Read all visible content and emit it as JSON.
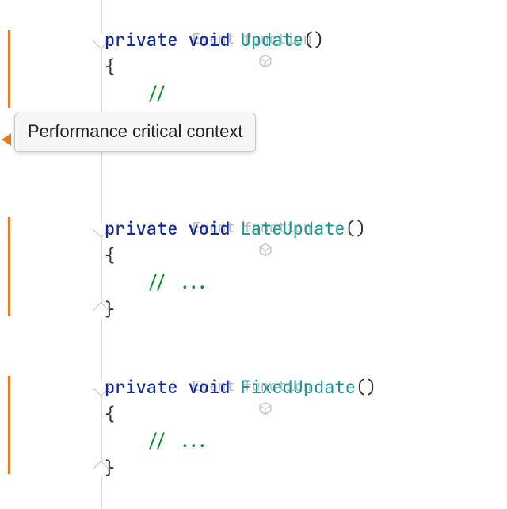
{
  "hint_label": "Event function",
  "tooltip_text": "Performance critical context",
  "keywords": {
    "private": "private",
    "void": "void"
  },
  "comment_body": "...",
  "methods": [
    {
      "name": "Update"
    },
    {
      "name": "LateUpdate"
    },
    {
      "name": "FixedUpdate"
    }
  ],
  "colors": {
    "perf_marker": "#ea7b1c",
    "keyword": "#10299c",
    "function": "#139696",
    "comment": "#0b8c2f",
    "hint": "#bdbdbd"
  }
}
